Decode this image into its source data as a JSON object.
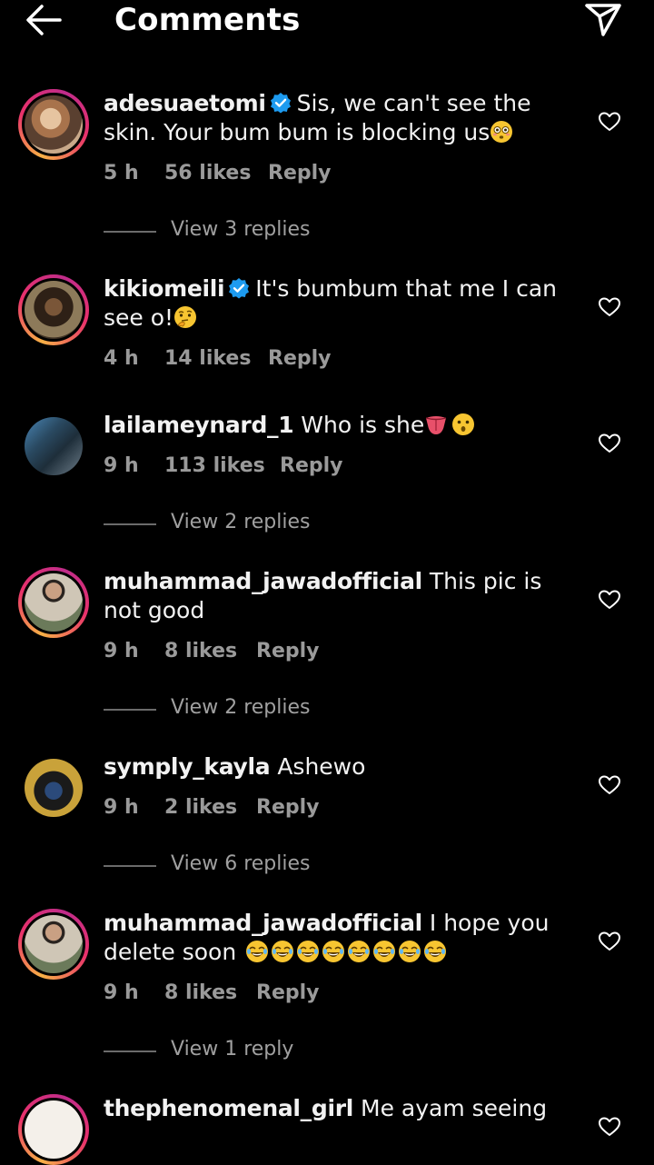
{
  "header": {
    "title": "Comments",
    "back_icon": "arrow-left-icon",
    "share_icon": "paper-plane-icon"
  },
  "colors": {
    "background": "#000000",
    "text": "#f2f2f2",
    "muted": "#9a9a9a",
    "verified": "#1d9bf0"
  },
  "comments": [
    {
      "username": "adesuaetomi",
      "verified": true,
      "text": "Sis, we can't see the skin. Your bum bum is blocking us",
      "emoji": "flushed-face",
      "time": "5 h",
      "likes": "56 likes",
      "reply": "Reply",
      "view_replies": "View 3 replies"
    },
    {
      "username": "kikiomeili",
      "verified": true,
      "text": "It's bumbum that me I can see o!",
      "emoji": "thinking-face",
      "time": "4 h",
      "likes": "14 likes",
      "reply": "Reply"
    },
    {
      "username": "lailameynard_1",
      "verified": false,
      "text": "Who is she",
      "emoji": "tongue, hushed-face",
      "time": "9 h",
      "likes": "113 likes",
      "reply": "Reply",
      "view_replies": "View 2 replies"
    },
    {
      "username": "muhammad_jawadofficial",
      "verified": false,
      "text": "This pic is not good",
      "time": "9 h",
      "likes": "8 likes",
      "reply": "Reply",
      "view_replies": "View 2 replies"
    },
    {
      "username": "symply_kayla",
      "verified": false,
      "text": "Ashewo",
      "time": "9 h",
      "likes": "2 likes",
      "reply": "Reply",
      "view_replies": "View 6 replies"
    },
    {
      "username": "muhammad_jawadofficial",
      "verified": false,
      "text": "I hope you delete soon",
      "emoji": "laughing-face x8",
      "time": "9 h",
      "likes": "8 likes",
      "reply": "Reply",
      "view_replies": "View 1 reply"
    },
    {
      "username": "thephenomenal_girl",
      "verified": false,
      "text": "Me ayam seeing"
    }
  ]
}
